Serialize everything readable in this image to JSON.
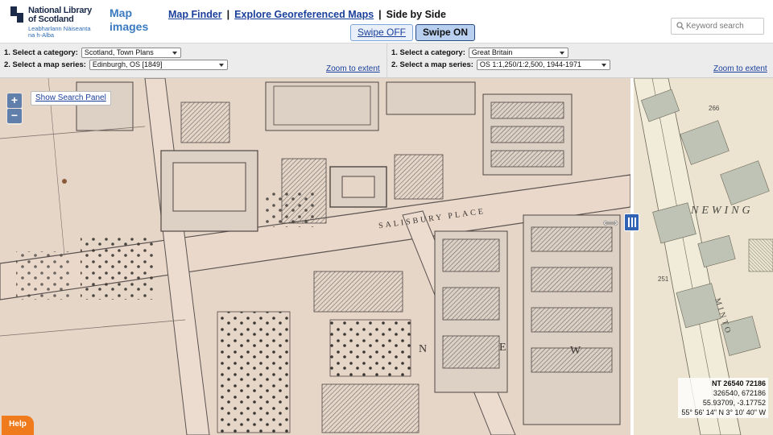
{
  "header": {
    "logo": {
      "line1": "National Library",
      "line2": "of Scotland",
      "gaelic1": "Leabharlann Nàiseanta",
      "gaelic2": "na h-Alba"
    },
    "site_title_line1": "Map",
    "site_title_line2": "images",
    "nav": {
      "map_finder": "Map Finder",
      "explore": "Explore Georeferenced Maps",
      "separator": "|",
      "current": "Side by Side"
    },
    "swipe": {
      "off_label": "Swipe OFF",
      "on_label": "Swipe ON"
    },
    "search": {
      "placeholder": "Keyword search"
    }
  },
  "left_panel": {
    "category_label": "1. Select a category:",
    "category_value": "Scotland, Town Plans",
    "series_label": "2. Select a map series:",
    "series_value": "Edinburgh, OS [1849]",
    "zoom_link": "Zoom to extent"
  },
  "right_panel": {
    "category_label": "1. Select a category:",
    "category_value": "Great Britain",
    "series_label": "2. Select a map series:",
    "series_value": "OS 1:1,250/1:2,500, 1944-1971",
    "zoom_link": "Zoom to extent"
  },
  "map": {
    "zoom_in": "+",
    "zoom_out": "−",
    "search_panel_button": "Show Search Panel",
    "swipe_arrow": "⟺",
    "labels": {
      "salisbury_place": "SALISBURY PLACE",
      "newington": "NEWING",
      "minto": "MINTO",
      "parcel_266": "266",
      "parcel_251": "251",
      "letter_n": "N",
      "letter_e": "E",
      "letter_w": "W"
    },
    "coords": {
      "grid_ref": "NT 26540 72186",
      "easting_northing": "326540, 672186",
      "latlon_decimal": "55.93709, -3.17752",
      "latlon_dms": "55° 56' 14\" N 3° 10' 40\" W"
    },
    "help_label": "Help"
  },
  "colors": {
    "old_map_paper": "#e8d9cc",
    "new_map_paper": "#ede6d2",
    "swipe_handle": "#3063b3",
    "help": "#f07b1d",
    "link": "#1a3f9b"
  }
}
